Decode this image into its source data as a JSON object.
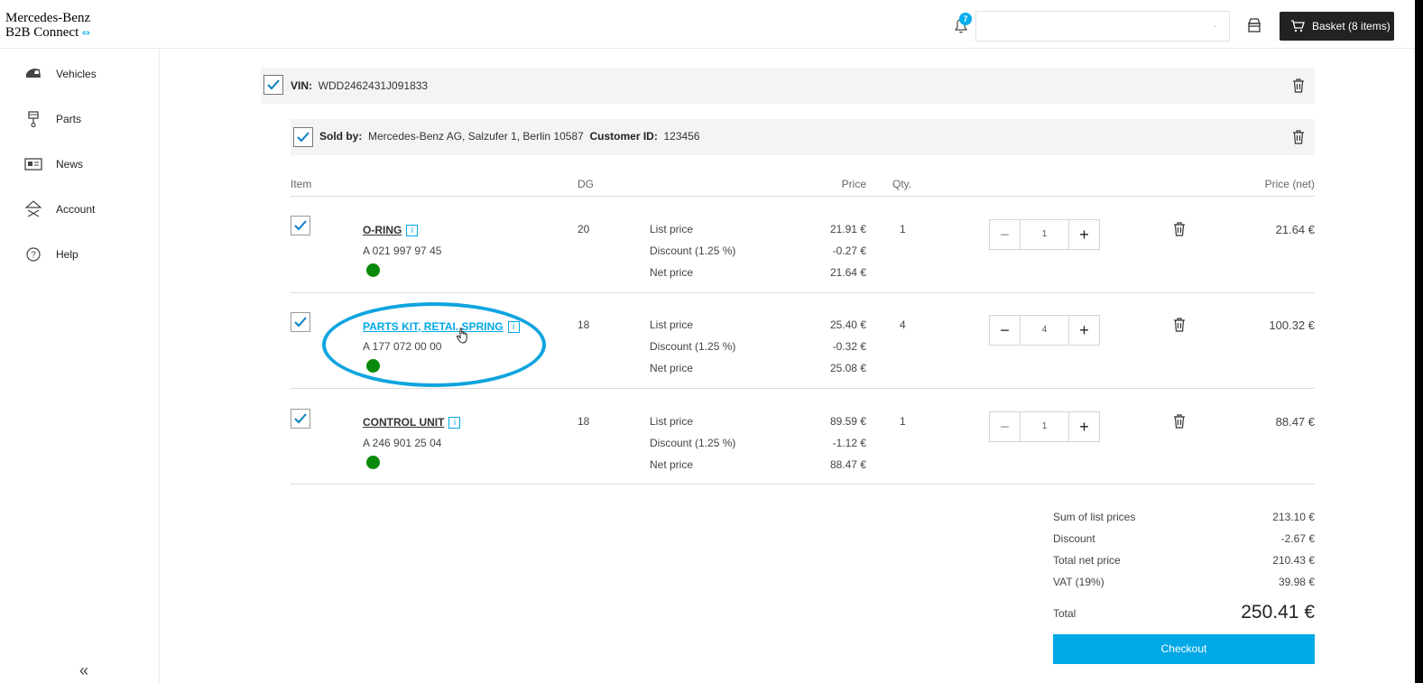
{
  "header": {
    "logo_line1": "Mercedes-Benz",
    "logo_line2": "B2B Connect",
    "logo_link_icon": "link-icon",
    "notification_count": "7",
    "search_value": "",
    "search_dropdown_marker": "·",
    "basket_label": "Basket (8 items)"
  },
  "sidebar": {
    "items": [
      {
        "label": "Vehicles",
        "icon": "car-icon"
      },
      {
        "label": "Parts",
        "icon": "piston-icon"
      },
      {
        "label": "News",
        "icon": "newspaper-icon"
      },
      {
        "label": "Account",
        "icon": "account-icon"
      },
      {
        "label": "Help",
        "icon": "help-icon"
      }
    ],
    "collapse_glyph": "«"
  },
  "vin_bar": {
    "label": "VIN:",
    "value": "WDD2462431J091833"
  },
  "sold_bar": {
    "sold_by_label": "Sold by:",
    "sold_by_value": "Mercedes-Benz AG, Salzufer 1, Berlin 10587",
    "customer_label": "Customer ID:",
    "customer_value": "123456"
  },
  "table": {
    "headers": {
      "item": "Item",
      "dg": "DG",
      "price": "Price",
      "qty": "Qty.",
      "price_net": "Price (net)"
    },
    "rows": [
      {
        "name": "O-RING",
        "part_no": "A 021 997 97 45",
        "dg": "20",
        "list_label": "List price",
        "discount_label": "Discount (1.25 %)",
        "net_label": "Net price",
        "list_price": "21.91 €",
        "discount": "-0.27 €",
        "net_price": "21.64 €",
        "qty": "1",
        "stepper_value": "1",
        "price_net": "21.64 €"
      },
      {
        "name": "PARTS KIT, RETAI. SPRING",
        "part_no": "A 177 072 00 00",
        "dg": "18",
        "list_label": "List price",
        "discount_label": "Discount (1.25 %)",
        "net_label": "Net price",
        "list_price": "25.40 €",
        "discount": "-0.32 €",
        "net_price": "25.08 €",
        "qty": "4",
        "stepper_value": "4",
        "price_net": "100.32 €"
      },
      {
        "name": "CONTROL UNIT",
        "part_no": "A 246 901 25 04",
        "dg": "18",
        "list_label": "List price",
        "discount_label": "Discount (1.25 %)",
        "net_label": "Net price",
        "list_price": "89.59 €",
        "discount": "-1.12 €",
        "net_price": "88.47 €",
        "qty": "1",
        "stepper_value": "1",
        "price_net": "88.47 €"
      }
    ],
    "info_glyph": "i",
    "minus_glyph": "−",
    "plus_glyph": "+"
  },
  "summary": {
    "sum_list_label": "Sum of list prices",
    "sum_list_value": "213.10 €",
    "discount_label": "Discount",
    "discount_value": "-2.67 €",
    "total_net_label": "Total net price",
    "total_net_value": "210.43 €",
    "vat_label": "VAT (19%)",
    "vat_value": "39.98 €",
    "total_label": "Total",
    "total_value": "250.41 €",
    "checkout_label": "Checkout"
  },
  "colors": {
    "accent": "#00a8e6",
    "availability": "#0a8a0a",
    "highlight": "#0ea4e0",
    "basket_bg": "#222222"
  }
}
